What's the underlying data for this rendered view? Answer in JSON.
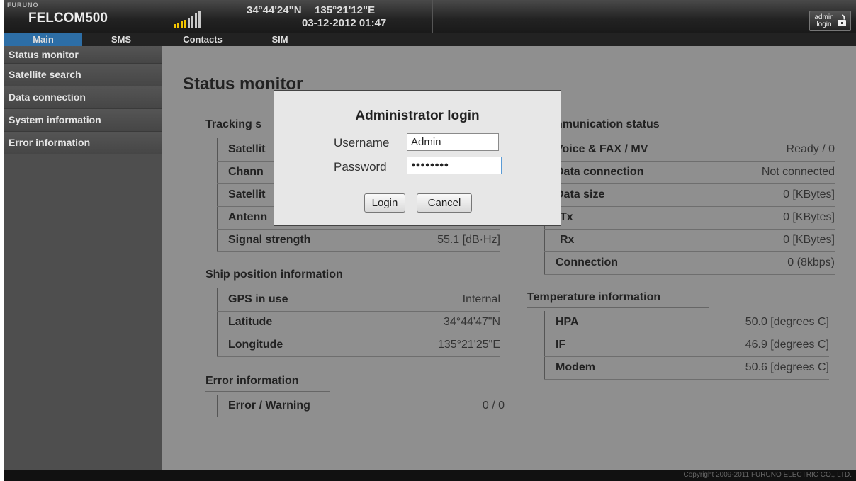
{
  "header": {
    "brand_small": "FURUNO",
    "brand_name": "FELCOM500",
    "coordinates": "34°44'24\"N   135°21'12\"E",
    "datetime": "03-12-2012 01:47",
    "signal_level": "4 of 8 bars lit",
    "admin_button_line1": "admin",
    "admin_button_line2": "login",
    "accent_color": "#f2c400"
  },
  "nav": {
    "tabs": [
      {
        "label": "Main",
        "active": true
      },
      {
        "label": "SMS"
      },
      {
        "label": "Contacts"
      },
      {
        "label": "SIM"
      }
    ],
    "active_color": "#2d6ea6"
  },
  "sidebar": {
    "items": [
      {
        "label": "Status monitor"
      },
      {
        "label": "Satellite search"
      },
      {
        "label": "Data connection"
      },
      {
        "label": "System information"
      },
      {
        "label": "Error information"
      }
    ]
  },
  "main": {
    "title": "Status monitor",
    "tracking": {
      "title": "Tracking s",
      "rows": [
        {
          "label": "Satellit",
          "value": ""
        },
        {
          "label": "Chann",
          "value": ""
        },
        {
          "label": "Satellit",
          "value": ""
        },
        {
          "label": "Antenn",
          "value": ""
        },
        {
          "label": "Signal strength",
          "value": "55.1 [dB·Hz]"
        }
      ]
    },
    "ship_position": {
      "title": "Ship position information",
      "rows": [
        {
          "label": "GPS in use",
          "value": "Internal"
        },
        {
          "label": "Latitude",
          "value": "34°44'47\"N"
        },
        {
          "label": "Longitude",
          "value": "135°21'25\"E"
        }
      ]
    },
    "error_info": {
      "title": "Error information",
      "rows": [
        {
          "label": "Error / Warning",
          "value": "0 / 0"
        }
      ]
    },
    "communication": {
      "title": "nmunication status",
      "rows": [
        {
          "label": "Voice & FAX / MV",
          "value": "Ready / 0"
        },
        {
          "label": "Data connection",
          "value": "Not connected"
        },
        {
          "label": "Data size",
          "value": "0 [KBytes]"
        },
        {
          "label": "Tx",
          "value": "0 [KBytes]"
        },
        {
          "label": "Rx",
          "value": "0 [KBytes]"
        },
        {
          "label": "Connection",
          "value": "0 (8kbps)"
        }
      ]
    },
    "temperature": {
      "title": "Temperature information",
      "rows": [
        {
          "label": "HPA",
          "value": "50.0 [degrees C]"
        },
        {
          "label": "IF",
          "value": "46.9 [degrees C]"
        },
        {
          "label": "Modem",
          "value": "50.6 [degrees C]"
        }
      ]
    }
  },
  "dialog": {
    "title": "Administrator login",
    "username_label": "Username",
    "username_value": "Admin",
    "password_label": "Password",
    "password_masked": "●●●●●●●●",
    "login_button": "Login",
    "cancel_button": "Cancel"
  },
  "footer": {
    "copyright": "Copyright 2009-2011 FURUNO ELECTRIC CO., LTD."
  }
}
